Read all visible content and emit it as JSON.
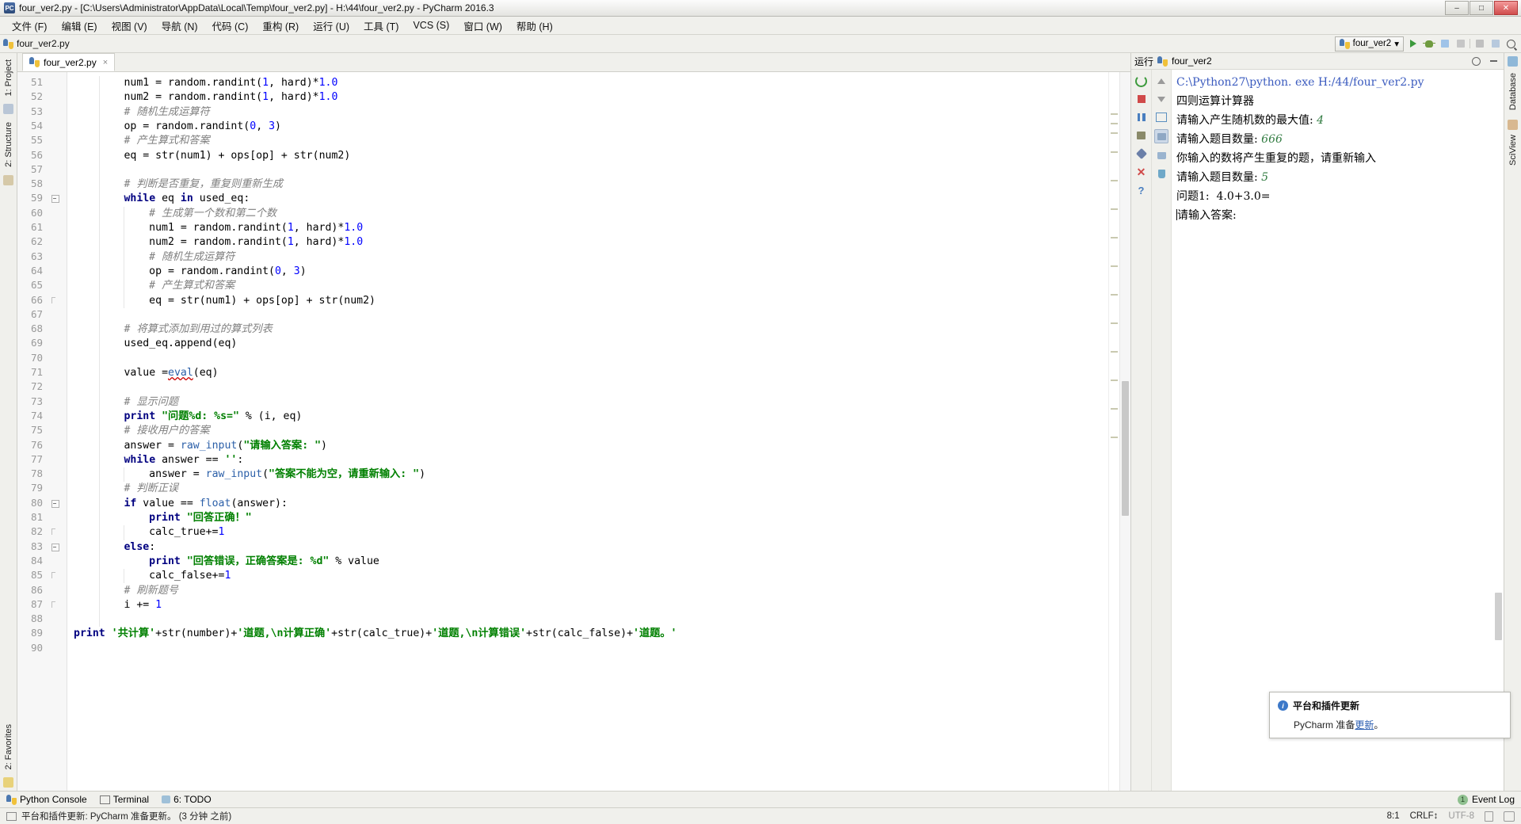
{
  "window": {
    "title": "four_ver2.py - [C:\\Users\\Administrator\\AppData\\Local\\Temp\\four_ver2.py] - H:\\44\\four_ver2.py - PyCharm 2016.3",
    "app_icon": "pycharm-icon",
    "minimize": "–",
    "maximize": "□",
    "close": "✕"
  },
  "menu": [
    {
      "label": "文件 (F)",
      "name": "menu-file"
    },
    {
      "label": "编辑 (E)",
      "name": "menu-edit"
    },
    {
      "label": "视图 (V)",
      "name": "menu-view"
    },
    {
      "label": "导航 (N)",
      "name": "menu-navigate"
    },
    {
      "label": "代码 (C)",
      "name": "menu-code"
    },
    {
      "label": "重构 (R)",
      "name": "menu-refactor"
    },
    {
      "label": "运行 (U)",
      "name": "menu-run"
    },
    {
      "label": "工具 (T)",
      "name": "menu-tools"
    },
    {
      "label": "VCS (S)",
      "name": "menu-vcs"
    },
    {
      "label": "窗口 (W)",
      "name": "menu-window"
    },
    {
      "label": "帮助 (H)",
      "name": "menu-help"
    }
  ],
  "navbar": {
    "breadcrumb": "four_ver2.py",
    "run_config": "four_ver2",
    "chevron": "▾"
  },
  "left_strip": {
    "project_tab": "1: Project",
    "structure_tab": "2: Structure",
    "favorites_tab": "2: Favorites"
  },
  "right_strip": {
    "database_tab": "Database",
    "second_tab": "SciView"
  },
  "editor": {
    "tab_label": "four_ver2.py",
    "tab_close": "×",
    "first_line_number": 51,
    "lines": [
      {
        "n": 51,
        "indent": 2,
        "parts": [
          {
            "t": "num1 = random.randint(",
            "c": ""
          },
          {
            "t": "1",
            "c": "num"
          },
          {
            "t": ", hard)*",
            "c": ""
          },
          {
            "t": "1.0",
            "c": "num"
          }
        ]
      },
      {
        "n": 52,
        "indent": 2,
        "parts": [
          {
            "t": "num2 = random.randint(",
            "c": ""
          },
          {
            "t": "1",
            "c": "num"
          },
          {
            "t": ", hard)*",
            "c": ""
          },
          {
            "t": "1.0",
            "c": "num"
          }
        ]
      },
      {
        "n": 53,
        "indent": 2,
        "parts": [
          {
            "t": "# 随机生成运算符",
            "c": "cmt"
          }
        ]
      },
      {
        "n": 54,
        "indent": 2,
        "parts": [
          {
            "t": "op = random.randint(",
            "c": ""
          },
          {
            "t": "0",
            "c": "num"
          },
          {
            "t": ", ",
            "c": ""
          },
          {
            "t": "3",
            "c": "num"
          },
          {
            "t": ")",
            "c": ""
          }
        ]
      },
      {
        "n": 55,
        "indent": 2,
        "parts": [
          {
            "t": "# 产生算式和答案",
            "c": "cmt"
          }
        ]
      },
      {
        "n": 56,
        "indent": 2,
        "parts": [
          {
            "t": "eq = str(num1) + ops[op] + str(num2)",
            "c": ""
          }
        ]
      },
      {
        "n": 57,
        "indent": 0,
        "parts": []
      },
      {
        "n": 58,
        "indent": 2,
        "parts": [
          {
            "t": "# 判断是否重复，重复则重新生成",
            "c": "cmt"
          }
        ]
      },
      {
        "n": 59,
        "indent": 2,
        "parts": [
          {
            "t": "while",
            "c": "kw"
          },
          {
            "t": " eq ",
            "c": ""
          },
          {
            "t": "in",
            "c": "kw"
          },
          {
            "t": " used_eq:",
            "c": ""
          }
        ]
      },
      {
        "n": 60,
        "indent": 3,
        "parts": [
          {
            "t": "# 生成第一个数和第二个数",
            "c": "cmt"
          }
        ]
      },
      {
        "n": 61,
        "indent": 3,
        "parts": [
          {
            "t": "num1 = random.randint(",
            "c": ""
          },
          {
            "t": "1",
            "c": "num"
          },
          {
            "t": ", hard)*",
            "c": ""
          },
          {
            "t": "1.0",
            "c": "num"
          }
        ]
      },
      {
        "n": 62,
        "indent": 3,
        "parts": [
          {
            "t": "num2 = random.randint(",
            "c": ""
          },
          {
            "t": "1",
            "c": "num"
          },
          {
            "t": ", hard)*",
            "c": ""
          },
          {
            "t": "1.0",
            "c": "num"
          }
        ]
      },
      {
        "n": 63,
        "indent": 3,
        "parts": [
          {
            "t": "# 随机生成运算符",
            "c": "cmt"
          }
        ]
      },
      {
        "n": 64,
        "indent": 3,
        "parts": [
          {
            "t": "op = random.randint(",
            "c": ""
          },
          {
            "t": "0",
            "c": "num"
          },
          {
            "t": ", ",
            "c": ""
          },
          {
            "t": "3",
            "c": "num"
          },
          {
            "t": ")",
            "c": ""
          }
        ]
      },
      {
        "n": 65,
        "indent": 3,
        "parts": [
          {
            "t": "# 产生算式和答案",
            "c": "cmt"
          }
        ]
      },
      {
        "n": 66,
        "indent": 3,
        "parts": [
          {
            "t": "eq = str(num1) + ops[op] + str(num2)",
            "c": ""
          }
        ]
      },
      {
        "n": 67,
        "indent": 0,
        "parts": []
      },
      {
        "n": 68,
        "indent": 2,
        "parts": [
          {
            "t": "# 将算式添加到用过的算式列表",
            "c": "cmt"
          }
        ]
      },
      {
        "n": 69,
        "indent": 2,
        "parts": [
          {
            "t": "used_eq.append(eq)",
            "c": ""
          }
        ]
      },
      {
        "n": 70,
        "indent": 0,
        "parts": []
      },
      {
        "n": 71,
        "indent": 2,
        "parts": [
          {
            "t": "value =",
            "c": ""
          },
          {
            "t": "eval",
            "c": "builtin err"
          },
          {
            "t": "(eq)",
            "c": ""
          }
        ]
      },
      {
        "n": 72,
        "indent": 0,
        "parts": []
      },
      {
        "n": 73,
        "indent": 2,
        "parts": [
          {
            "t": "# 显示问题",
            "c": "cmt"
          }
        ]
      },
      {
        "n": 74,
        "indent": 2,
        "parts": [
          {
            "t": "print",
            "c": "kw"
          },
          {
            "t": " ",
            "c": ""
          },
          {
            "t": "\"问题%d: %s=\"",
            "c": "str"
          },
          {
            "t": " % (i, eq)",
            "c": ""
          }
        ]
      },
      {
        "n": 75,
        "indent": 2,
        "parts": [
          {
            "t": "# 接收用户的答案",
            "c": "cmt"
          }
        ]
      },
      {
        "n": 76,
        "indent": 2,
        "parts": [
          {
            "t": "answer = ",
            "c": ""
          },
          {
            "t": "raw_input",
            "c": "builtin"
          },
          {
            "t": "(",
            "c": ""
          },
          {
            "t": "\"请输入答案: \"",
            "c": "str"
          },
          {
            "t": ")",
            "c": ""
          }
        ]
      },
      {
        "n": 77,
        "indent": 2,
        "parts": [
          {
            "t": "while",
            "c": "kw"
          },
          {
            "t": " answer == ",
            "c": ""
          },
          {
            "t": "''",
            "c": "str"
          },
          {
            "t": ":",
            "c": ""
          }
        ]
      },
      {
        "n": 78,
        "indent": 3,
        "parts": [
          {
            "t": "answer = ",
            "c": ""
          },
          {
            "t": "raw_input",
            "c": "builtin"
          },
          {
            "t": "(",
            "c": ""
          },
          {
            "t": "\"答案不能为空，请重新输入: \"",
            "c": "str"
          },
          {
            "t": ")",
            "c": ""
          }
        ]
      },
      {
        "n": 79,
        "indent": 2,
        "parts": [
          {
            "t": "# 判断正误",
            "c": "cmt"
          }
        ]
      },
      {
        "n": 80,
        "indent": 2,
        "parts": [
          {
            "t": "if",
            "c": "kw"
          },
          {
            "t": " value == ",
            "c": ""
          },
          {
            "t": "float",
            "c": "builtin"
          },
          {
            "t": "(answer):",
            "c": ""
          }
        ]
      },
      {
        "n": 81,
        "indent": 3,
        "parts": [
          {
            "t": "print",
            "c": "kw"
          },
          {
            "t": " ",
            "c": ""
          },
          {
            "t": "\"回答正确！\"",
            "c": "str"
          }
        ]
      },
      {
        "n": 82,
        "indent": 3,
        "parts": [
          {
            "t": "calc_true+=",
            "c": ""
          },
          {
            "t": "1",
            "c": "num"
          }
        ]
      },
      {
        "n": 83,
        "indent": 2,
        "parts": [
          {
            "t": "else",
            "c": "kw"
          },
          {
            "t": ":",
            "c": ""
          }
        ]
      },
      {
        "n": 84,
        "indent": 3,
        "parts": [
          {
            "t": "print",
            "c": "kw"
          },
          {
            "t": " ",
            "c": ""
          },
          {
            "t": "\"回答错误，正确答案是: %d\"",
            "c": "str"
          },
          {
            "t": " % value",
            "c": ""
          }
        ]
      },
      {
        "n": 85,
        "indent": 3,
        "parts": [
          {
            "t": "calc_false+=",
            "c": ""
          },
          {
            "t": "1",
            "c": "num"
          }
        ]
      },
      {
        "n": 86,
        "indent": 2,
        "parts": [
          {
            "t": "# 刷新题号",
            "c": "cmt"
          }
        ]
      },
      {
        "n": 87,
        "indent": 2,
        "parts": [
          {
            "t": "i += ",
            "c": ""
          },
          {
            "t": "1",
            "c": "num"
          }
        ]
      },
      {
        "n": 88,
        "indent": 0,
        "parts": []
      },
      {
        "n": 89,
        "indent": 0,
        "parts": [
          {
            "t": "print",
            "c": "kw"
          },
          {
            "t": " ",
            "c": ""
          },
          {
            "t": "'共计算'",
            "c": "str"
          },
          {
            "t": "+str(number)+",
            "c": ""
          },
          {
            "t": "'道题,\\n计算正确'",
            "c": "str"
          },
          {
            "t": "+str(calc_true)+",
            "c": ""
          },
          {
            "t": "'道题,\\n计算错误'",
            "c": "str"
          },
          {
            "t": "+str(calc_false)+",
            "c": ""
          },
          {
            "t": "'道题。'",
            "c": "str"
          }
        ]
      },
      {
        "n": 90,
        "indent": 0,
        "parts": []
      }
    ]
  },
  "run_window": {
    "title": "运行",
    "config_name": "four_ver2",
    "console": [
      {
        "text": "C:\\Python27\\python. exe H:/44/four_ver2.py",
        "style": "cmd"
      },
      {
        "text": "四则运算计算器",
        "style": "out"
      },
      {
        "text": "请输入产生随机数的最大值: ",
        "style": "out",
        "input": "4"
      },
      {
        "text": "请输入题目数量: ",
        "style": "out",
        "input": "666"
      },
      {
        "text": "你输入的数将产生重复的题，请重新输入",
        "style": "out"
      },
      {
        "text": "请输入题目数量: ",
        "style": "out",
        "input": "5"
      },
      {
        "text": "问题1:  4.0+3.0=",
        "style": "out"
      },
      {
        "text": "请输入答案: ",
        "style": "out",
        "caret": true
      }
    ],
    "tool_icons": [
      "rerun-icon",
      "stop-icon",
      "pause-icon",
      "print-output-icon",
      "pin-icon",
      "close-icon",
      "help-icon"
    ],
    "side_icons": [
      "scroll-up-icon",
      "scroll-down-icon",
      "soft-wrap-icon",
      "scroll-to-end-icon",
      "print-icon",
      "trash-icon"
    ]
  },
  "bottom_bar": {
    "items": [
      {
        "label": "Python Console",
        "icon": "python-console-icon",
        "name": "tool-python-console"
      },
      {
        "label": "Terminal",
        "icon": "terminal-icon",
        "name": "tool-terminal"
      },
      {
        "label": "6: TODO",
        "icon": "todo-icon",
        "name": "tool-todo"
      }
    ],
    "event_log": "Event Log",
    "event_count": "1"
  },
  "status_bar": {
    "message": "平台和插件更新: PyCharm 准备更新。 (3 分钟 之前)",
    "caret_position": "8:1",
    "line_separator": "CRLF↕",
    "encoding": "UTF-8",
    "lock_icon": "lock-icon",
    "inspection_icon": "inspection-icon"
  },
  "notification": {
    "title": "平台和插件更新",
    "body_prefix": "PyCharm 准备",
    "link": "更新",
    "body_suffix": "。"
  }
}
